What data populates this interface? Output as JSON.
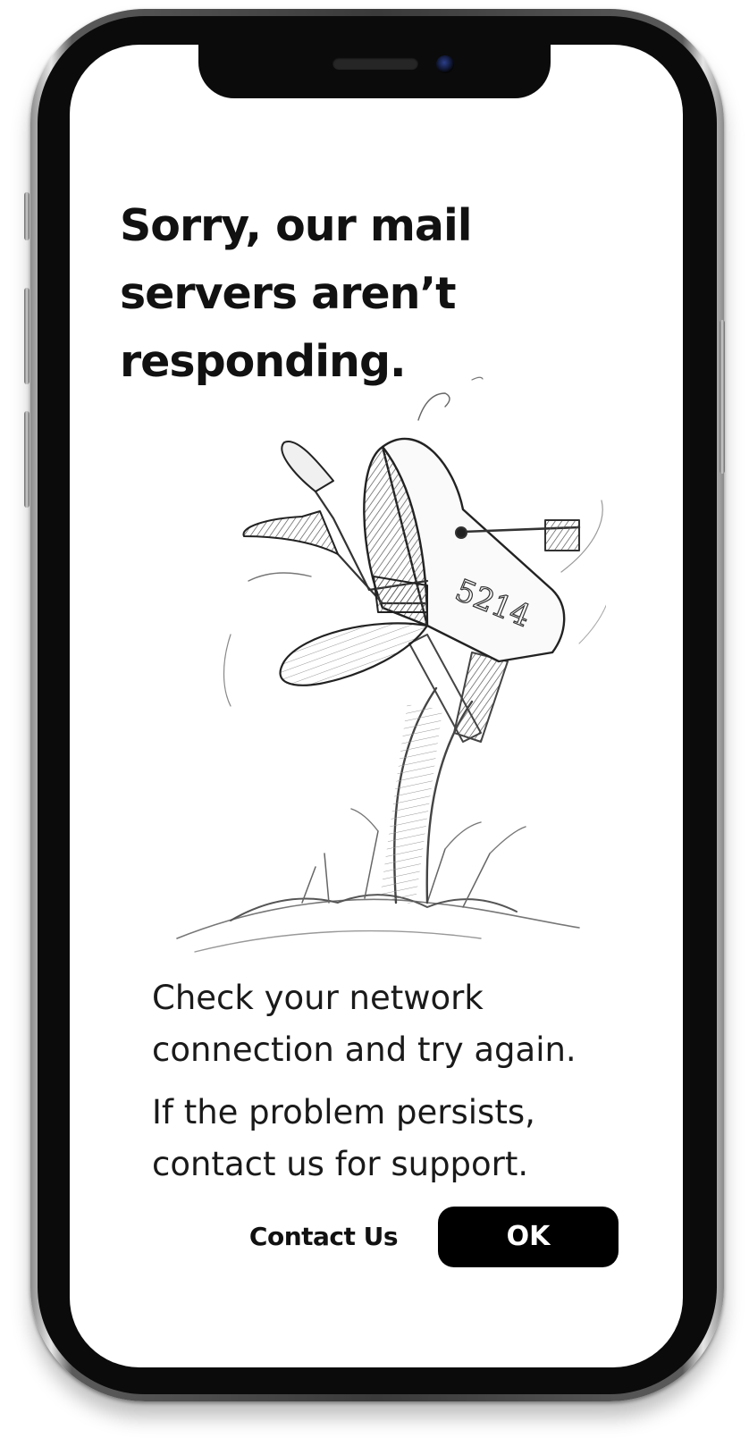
{
  "dialog": {
    "title": "Sorry, our mail servers aren’t responding.",
    "paragraphs": [
      "Check your network connection and try again.",
      "If the problem persists, contact us for support."
    ],
    "illustration": {
      "mailbox_number": "5214"
    }
  },
  "actions": {
    "contact_label": "Contact Us",
    "ok_label": "OK"
  },
  "colors": {
    "text": "#111111",
    "primary_button_bg": "#000000",
    "primary_button_text": "#ffffff",
    "screen_bg": "#ffffff"
  }
}
